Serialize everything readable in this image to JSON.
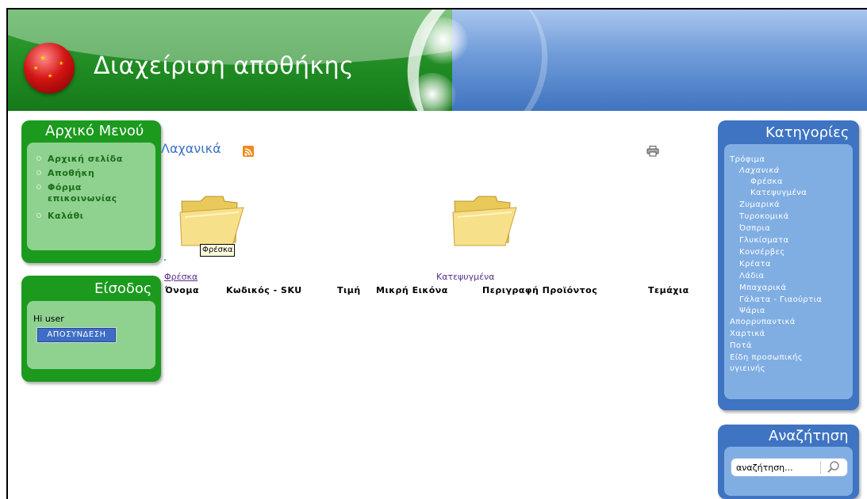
{
  "header": {
    "title": "Διαχείριση αποθήκης"
  },
  "left_menu": {
    "title": "Αρχικό Μενού",
    "items": [
      {
        "label": "Αρχική σελίδα"
      },
      {
        "label": "Αποθήκη"
      },
      {
        "label": "Φόρμα"
      },
      {
        "label": "επικοινωνίας"
      },
      {
        "label": "Καλάθι"
      }
    ]
  },
  "login": {
    "title": "Είσοδος",
    "greeting": "Hi user",
    "logout_label": "ΑΠΟΣΥΝΔΕΣΗ"
  },
  "main": {
    "title": "Λαχανικά",
    "tooltip": "Φρέσκα",
    "subcategories": [
      {
        "label": "Φρέσκα"
      },
      {
        "label": "Κατεψυγμένα"
      }
    ],
    "table_headers": [
      "Όνομα",
      "Κωδικός - SKU",
      "Τιμή",
      "Μικρή Εικόνα",
      "Περιγραφή Προϊόντος",
      "Τεμάχια"
    ]
  },
  "categories": {
    "title": "Κατηγορίες",
    "items": [
      {
        "label": "Τρόφιμα",
        "level": 0
      },
      {
        "label": "Λαχανικά",
        "level": 1
      },
      {
        "label": "Φρέσκα",
        "level": 2
      },
      {
        "label": "Κατεψυγμένα",
        "level": 2
      },
      {
        "label": "Ζυμαρικά",
        "level": 1
      },
      {
        "label": "Τυροκομικά",
        "level": 1
      },
      {
        "label": "Όσπρια",
        "level": 1
      },
      {
        "label": "Γλυκίσματα",
        "level": 1
      },
      {
        "label": "Κονσέρβες",
        "level": 1
      },
      {
        "label": "Κρέατα",
        "level": 1
      },
      {
        "label": "Λάδια",
        "level": 1
      },
      {
        "label": "Μπαχαρικά",
        "level": 1
      },
      {
        "label": "Γάλατα - Γιαούρτια",
        "level": 1
      },
      {
        "label": "Ψάρια",
        "level": 1
      },
      {
        "label": "Απορρυπαντικά",
        "level": 0
      },
      {
        "label": "Χαρτικά",
        "level": 0
      },
      {
        "label": "Ποτά",
        "level": 0
      },
      {
        "label": "Είδη προσωπικής",
        "level": 0
      },
      {
        "label": "υγιεινής",
        "level": 0
      }
    ]
  },
  "search": {
    "title": "Αναζήτηση",
    "placeholder": "αναζήτηση..."
  },
  "colors": {
    "green": "#1b9a1e",
    "blue": "#3e74c2",
    "link": "#5b2f8c"
  }
}
